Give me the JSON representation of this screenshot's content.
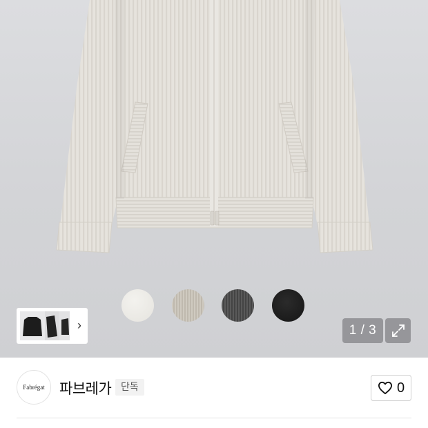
{
  "gallery": {
    "image_alt": "Light beige ribbed knit full-zip cardigan",
    "page_indicator": "1 / 3",
    "current_page": 1,
    "total_pages": 3,
    "color_swatches": [
      {
        "name": "ivory",
        "color": "#ebe9e4"
      },
      {
        "name": "beige",
        "color": "#c8c2b7"
      },
      {
        "name": "charcoal",
        "color": "#505050"
      },
      {
        "name": "black",
        "color": "#1e1e1e"
      }
    ],
    "thumbnail_chevron": "›"
  },
  "brand": {
    "logo_text": "Fabrégat",
    "name": "파브레가",
    "badge": "단독"
  },
  "like": {
    "count": "0",
    "icon": "heart-outline-icon"
  },
  "colors": {
    "hero_background": "#d6d7da",
    "overlay_button": "#808084"
  }
}
